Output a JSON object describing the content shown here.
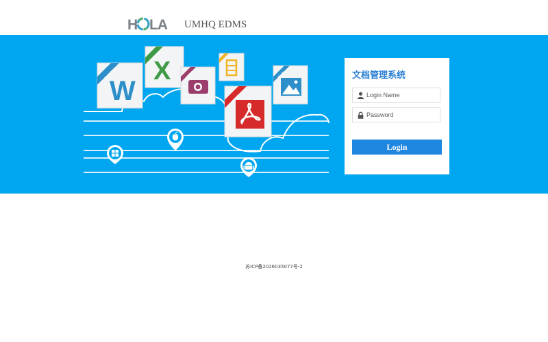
{
  "header": {
    "logo_text": "HOLA",
    "app_name": "UMHQ EDMS"
  },
  "illustration": {
    "file_types": [
      "DOCX",
      "XLSX",
      "JPEG",
      "PDF",
      "BMP"
    ],
    "platforms": [
      "windows-icon",
      "apple-icon",
      "android-icon"
    ]
  },
  "login": {
    "title": "文档管理系统",
    "username_placeholder": "Login Name",
    "password_placeholder": "Password",
    "button_label": "Login"
  },
  "footer": {
    "icp": "苏ICP备2026035077号-2"
  },
  "colors": {
    "band": "#00a6ef",
    "accent": "#1f87e0",
    "title": "#2a7fd4"
  }
}
